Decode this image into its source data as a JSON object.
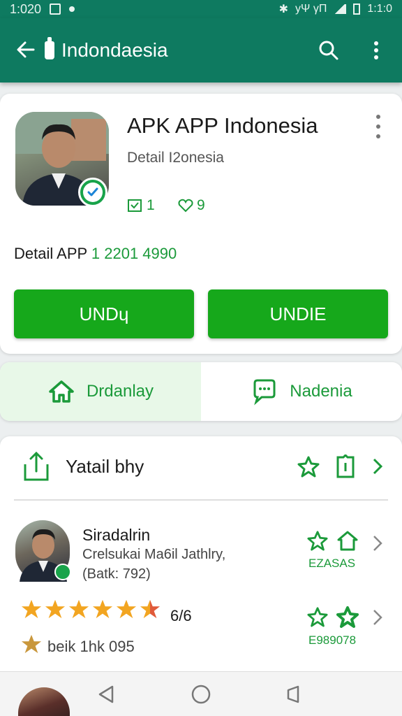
{
  "status_bar": {
    "time": "1:020",
    "right_time": "1:1:0",
    "signal_text": "уΨ γΠ"
  },
  "toolbar": {
    "title": "Indondaesia"
  },
  "app": {
    "name": "APK APP Indonesia",
    "subtitle": "Detail I2onesia",
    "stat1": "1",
    "stat2": "9",
    "detail_label": "Detail APP",
    "detail_number": "1 2201 4990",
    "button1": "UNDɥ",
    "button2": "UNDIE"
  },
  "tabs": [
    {
      "label": "Drdanlay"
    },
    {
      "label": "Nadenia"
    }
  ],
  "list": {
    "header_label": "Yatail bhy",
    "reviewer": {
      "name": "Siradalrin",
      "description": "Crelsukai Ma6il Jathlry,",
      "count": "(Batk: 792)"
    },
    "code1": "EZASAS",
    "code2": "E989078",
    "rating_text": "6/6",
    "low_text": "beik 1hk 095"
  },
  "colors": {
    "toolbar": "#0e7a60",
    "button_green": "#16a81b",
    "accent_green": "#1b9a3a",
    "star": "#f2a521"
  },
  "icons": [
    "back-arrow-icon",
    "search-icon",
    "overflow-menu-icon",
    "verified-check-icon",
    "share-icon",
    "star-icon",
    "bookmark-icon",
    "chevron-right-icon",
    "home-icon",
    "chat-icon"
  ]
}
